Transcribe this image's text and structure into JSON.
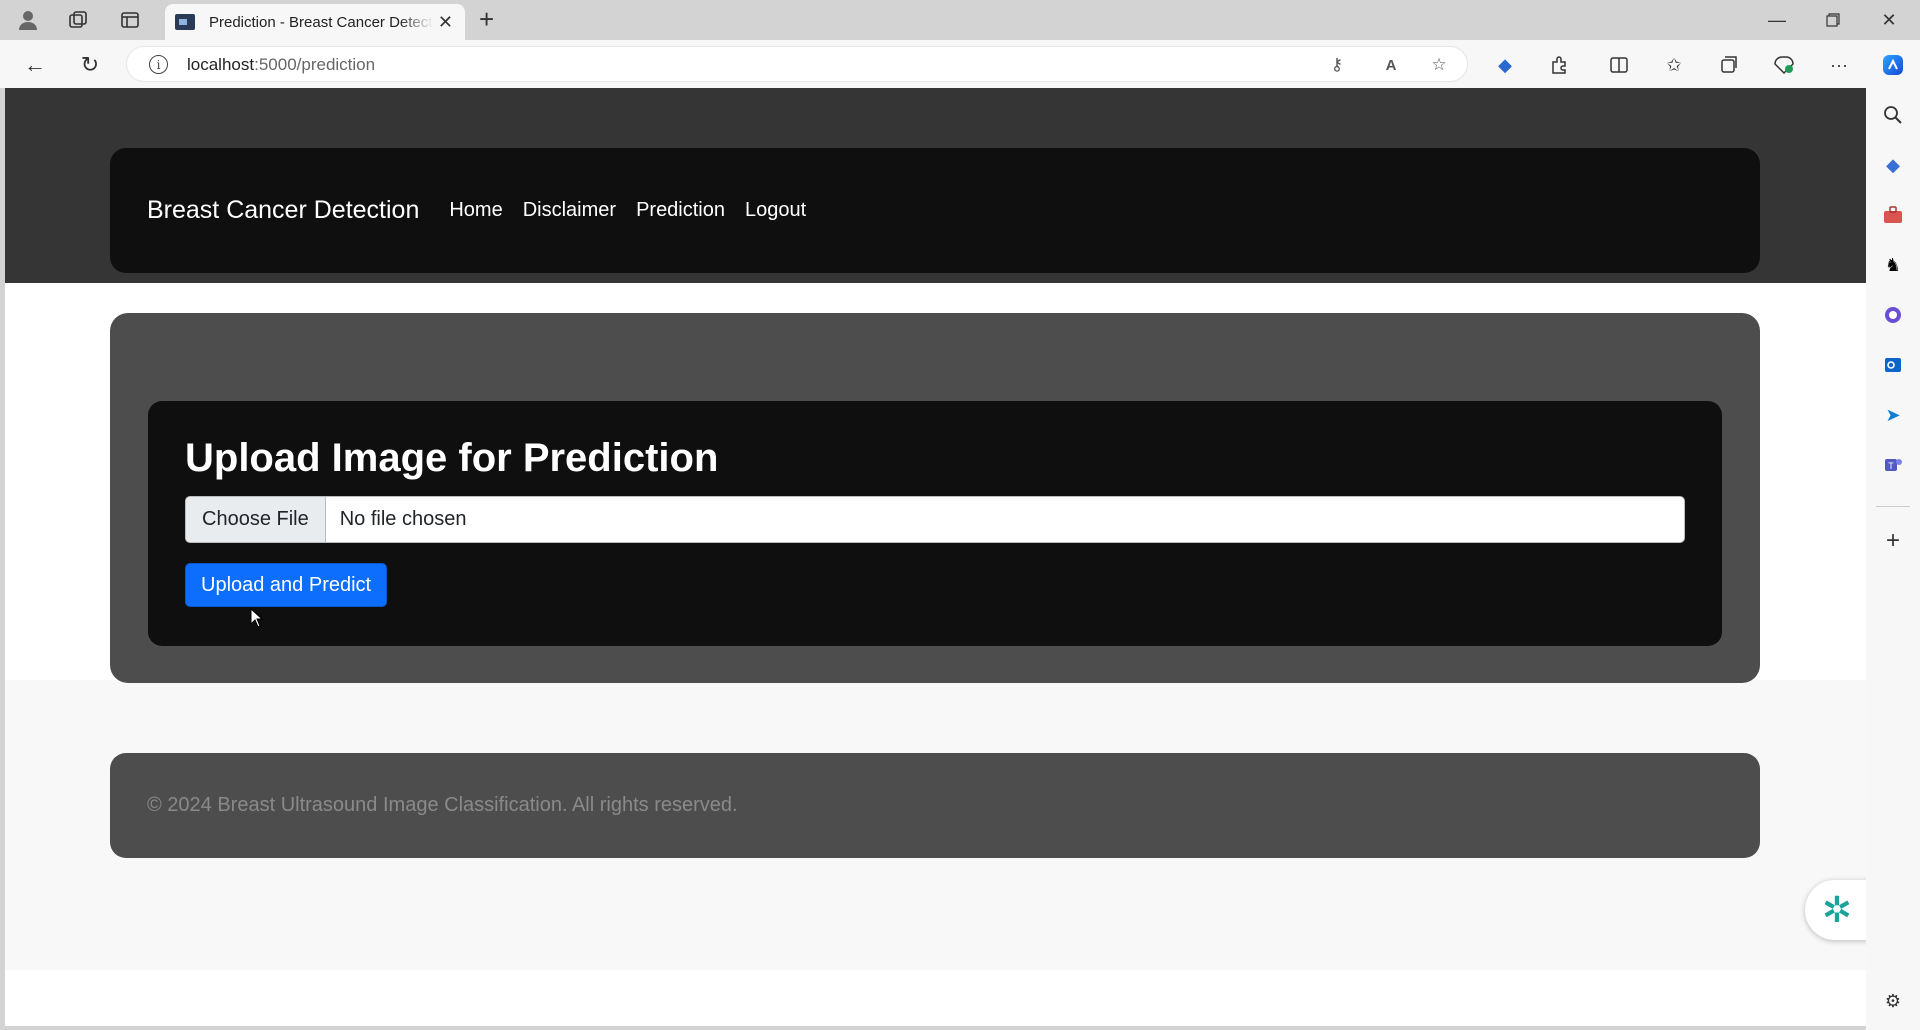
{
  "browser": {
    "tab_title": "Prediction - Breast Cancer Detection",
    "url_host": "localhost",
    "url_rest": ":5000/prediction",
    "colors": {
      "chrome": "#d3d3d3",
      "toolbar": "#f7f7f7"
    }
  },
  "navbar": {
    "brand": "Breast Cancer Detection",
    "links": [
      "Home",
      "Disclaimer",
      "Prediction",
      "Logout"
    ]
  },
  "upload": {
    "title": "Upload Image for Prediction",
    "choose_file": "Choose File",
    "no_file": "No file chosen",
    "submit": "Upload and Predict"
  },
  "footer": {
    "text": "© 2024 Breast Ultrasound Image Classification. All rights reserved."
  },
  "theme": {
    "hero": "#353535",
    "navbar": "#0f0f0f",
    "panel": "#4d4d4d",
    "primary": "#0d6efd"
  }
}
